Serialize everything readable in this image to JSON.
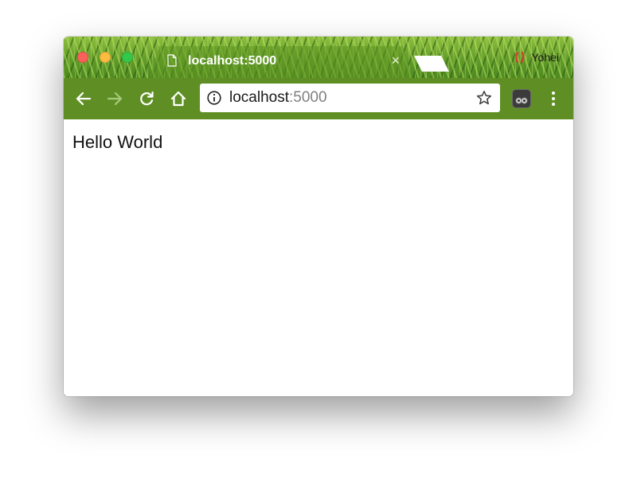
{
  "window": {
    "controls": [
      "close",
      "minimize",
      "maximize"
    ]
  },
  "tab": {
    "title": "localhost:5000",
    "close_glyph": "×",
    "icon": "document-icon"
  },
  "profile": {
    "name": "Yohei",
    "icon": "profile-icon"
  },
  "toolbar": {
    "back_icon": "back-arrow-icon",
    "forward_icon": "forward-arrow-icon",
    "reload_icon": "reload-icon",
    "home_icon": "home-icon",
    "extension_icon": "extension-icon",
    "menu_icon": "menu-dots-icon"
  },
  "omnibox": {
    "host": "localhost",
    "port": ":5000",
    "info_icon": "info-icon",
    "bookmark_icon": "star-icon"
  },
  "page": {
    "text": "Hello World"
  },
  "colors": {
    "toolbar": "#5f8f24",
    "close": "#fc605b",
    "minimize": "#fdbc40",
    "maximize": "#34c84a"
  }
}
